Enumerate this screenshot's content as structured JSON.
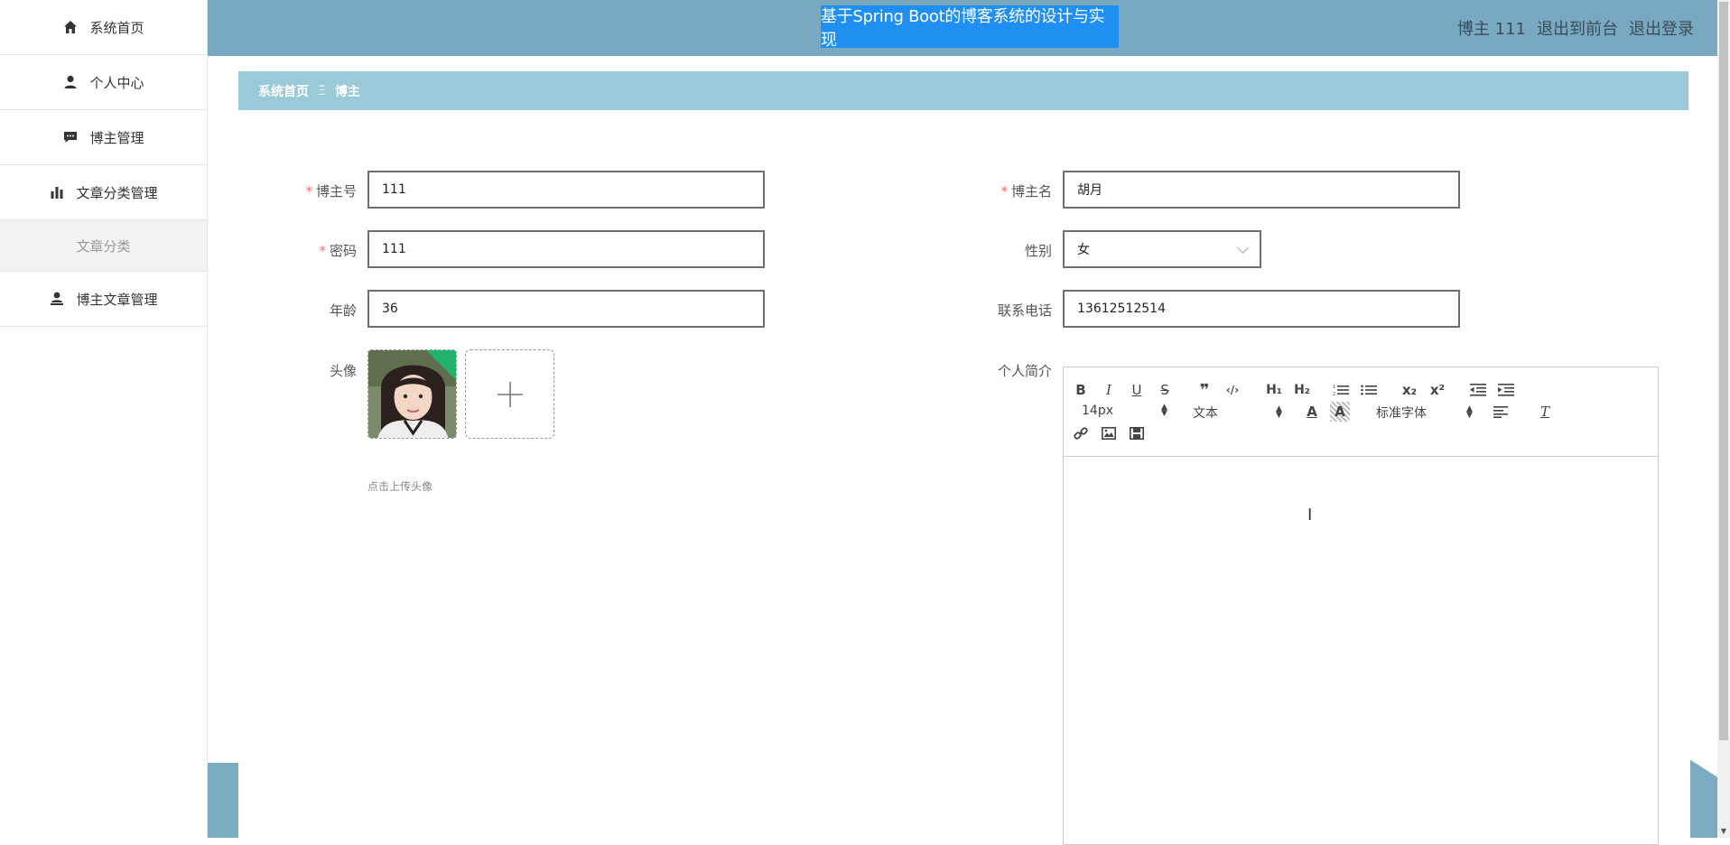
{
  "sidebar": {
    "items": [
      {
        "label": "系统首页",
        "icon": "home-icon"
      },
      {
        "label": "个人中心",
        "icon": "user-icon"
      },
      {
        "label": "博主管理",
        "icon": "chat-icon"
      },
      {
        "label": "文章分类管理",
        "icon": "bar-chart-icon"
      },
      {
        "label": "文章分类",
        "icon": ""
      },
      {
        "label": "博主文章管理",
        "icon": "user-stamp-icon"
      }
    ]
  },
  "header": {
    "title": "基于Spring Boot的博客系统的设计与实现",
    "user": "博主 111",
    "to_front": "退出到前台",
    "logout": "退出登录"
  },
  "breadcrumb": {
    "home": "系统首页",
    "separator": "Ξ",
    "current": "博主"
  },
  "form": {
    "account_label": "博主号",
    "account_value": "111",
    "name_label": "博主名",
    "name_value": "胡月",
    "password_label": "密码",
    "password_value": "111",
    "gender_label": "性别",
    "gender_value": "女",
    "age_label": "年龄",
    "age_value": "36",
    "phone_label": "联系电话",
    "phone_value": "13612512514",
    "avatar_label": "头像",
    "avatar_tip": "点击上传头像",
    "intro_label": "个人简介"
  },
  "editor": {
    "font_size": "14px",
    "text_type": "文本",
    "font_family": "标准字体"
  },
  "colors": {
    "header_bg": "#78a9c0",
    "title_highlight": "#1f8ff2",
    "breadcrumb_bg": "#9ac9d7",
    "required": "#f56c6c"
  }
}
